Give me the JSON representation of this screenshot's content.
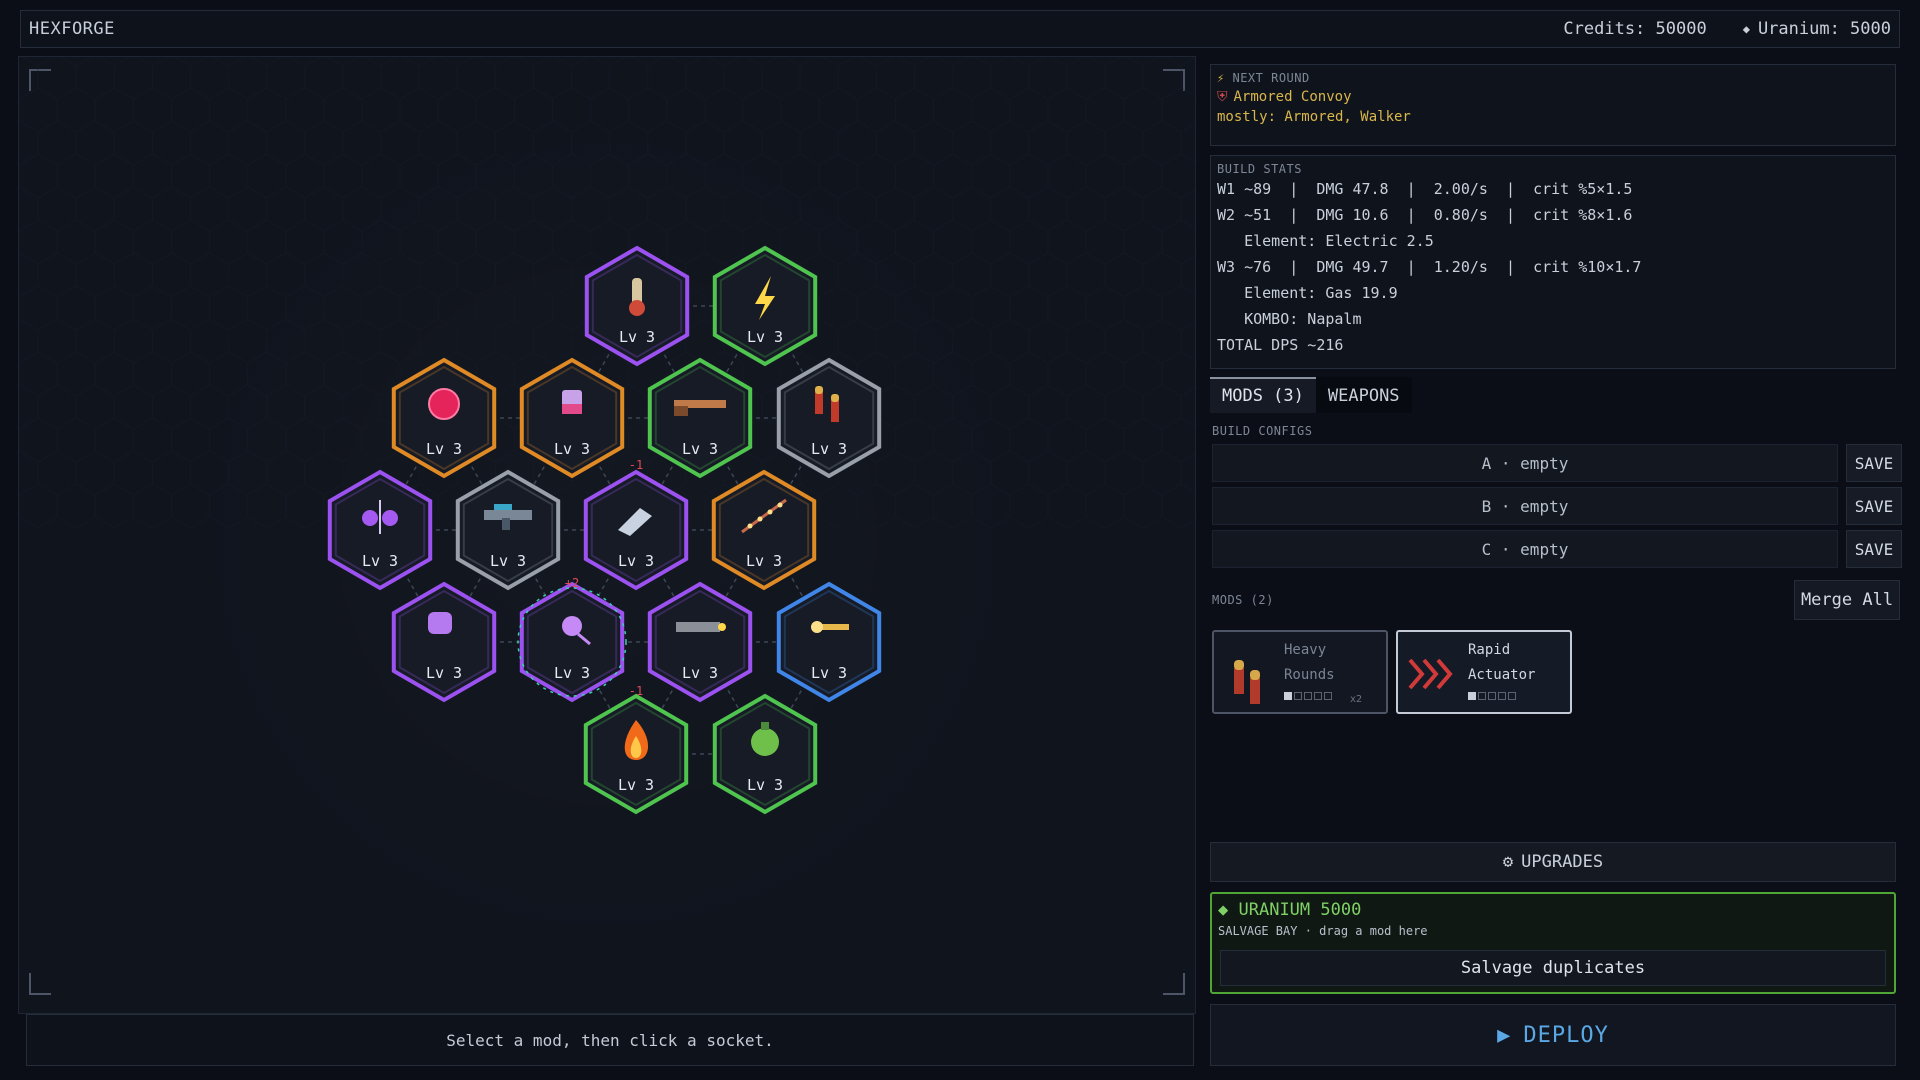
{
  "app": {
    "title": "HEXFORGE"
  },
  "resources": {
    "credits_label": "Credits: 50000",
    "uranium_label": "Uranium: 5000",
    "uranium_icon": "uranium-diamond-icon"
  },
  "board": {
    "hint": "Select a mod, then click a socket.",
    "cells": [
      {
        "level": "Lv 3",
        "color": "#9b52f0",
        "icon": "thermometer-icon"
      },
      {
        "level": "Lv 3",
        "color": "#4fc44f",
        "icon": "lightning-icon"
      },
      {
        "level": "Lv 3",
        "color": "#e08a26",
        "icon": "red-orb-icon"
      },
      {
        "level": "Lv 3",
        "color": "#e08a26",
        "icon": "canister-icon"
      },
      {
        "level": "Lv 3",
        "color": "#4fc44f",
        "icon": "shotgun-icon"
      },
      {
        "level": "Lv 3",
        "color": "#9aa0aa",
        "icon": "bullets-icon"
      },
      {
        "level": "Lv 3",
        "color": "#9b52f0",
        "icon": "split-orb-icon"
      },
      {
        "level": "Lv 3",
        "color": "#9aa0aa",
        "icon": "rifle-icon"
      },
      {
        "level": "Lv 3",
        "color": "#9b52f0",
        "icon": "gauntlet-icon"
      },
      {
        "level": "Lv 3",
        "color": "#e08a26",
        "icon": "sparkle-staff-icon"
      },
      {
        "level": "Lv 3",
        "color": "#9b52f0",
        "icon": "purple-blob-icon"
      },
      {
        "level": "Lv 3",
        "color": "#9b52f0",
        "icon": "purple-spiral-icon"
      },
      {
        "level": "Lv 3",
        "color": "#9b52f0",
        "icon": "minigun-icon"
      },
      {
        "level": "Lv 3",
        "color": "#3f86e8",
        "icon": "blaster-icon"
      },
      {
        "level": "Lv 3",
        "color": "#4fc44f",
        "icon": "flame-icon"
      },
      {
        "level": "Lv 3",
        "color": "#4fc44f",
        "icon": "gas-grenade-icon"
      }
    ],
    "badges": [
      "-1",
      "+2",
      "-1"
    ]
  },
  "next_round": {
    "label": "NEXT ROUND",
    "enemy": "Armored Convoy",
    "composition": "mostly: Armored, Walker"
  },
  "build_stats": {
    "label": "BUILD STATS",
    "lines": [
      "W1 ~89  |  DMG 47.8  |  2.00/s  |  crit %5×1.5",
      "W2 ~51  |  DMG 10.6  |  0.80/s  |  crit %8×1.6",
      "   Element: Electric 2.5",
      "W3 ~76  |  DMG 49.7  |  1.20/s  |  crit %10×1.7",
      "   Element: Gas 19.9",
      "   KOMBO: Napalm",
      "TOTAL DPS ~216"
    ]
  },
  "tabs": {
    "mods": "MODS (3)",
    "weapons": "WEAPONS"
  },
  "build_configs": {
    "label": "BUILD CONFIGS",
    "slots": [
      {
        "text": "A · empty",
        "save": "SAVE"
      },
      {
        "text": "B · empty",
        "save": "SAVE"
      },
      {
        "text": "C · empty",
        "save": "SAVE"
      }
    ]
  },
  "mods": {
    "label": "MODS (2)",
    "merge": "Merge All",
    "cards": [
      {
        "line1": "Heavy",
        "line2": "Rounds",
        "count": "x2",
        "icon": "bullets-icon",
        "pips_filled": 1,
        "pips_total": 5
      },
      {
        "line1": "Rapid",
        "line2": "Actuator",
        "count": "",
        "icon": "chevrons-icon",
        "pips_filled": 1,
        "pips_total": 5
      }
    ]
  },
  "upgrades": {
    "label": "UPGRADES",
    "icon": "gear-icon"
  },
  "salvage": {
    "uranium": "URANIUM 5000",
    "subtitle": "SALVAGE BAY · drag a mod here",
    "button": "Salvage duplicates"
  },
  "deploy": {
    "label": "DEPLOY",
    "icon": "play-icon"
  }
}
